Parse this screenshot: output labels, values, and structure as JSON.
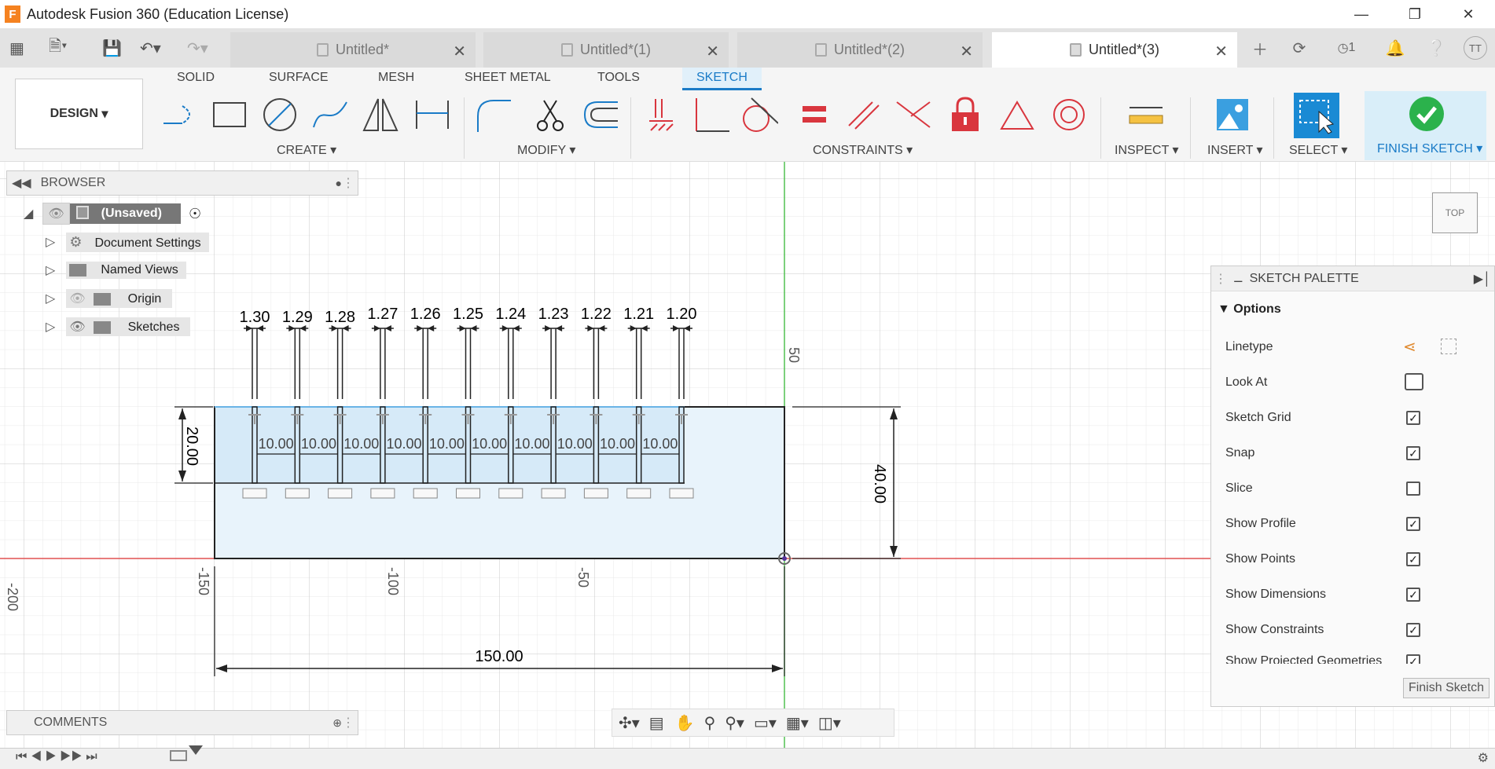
{
  "window": {
    "title": "Autodesk Fusion 360 (Education License)",
    "logo": "F"
  },
  "tabs": [
    {
      "label": "Untitled*",
      "active": false
    },
    {
      "label": "Untitled*(1)",
      "active": false
    },
    {
      "label": "Untitled*(2)",
      "active": false
    },
    {
      "label": "Untitled*(3)",
      "active": true
    }
  ],
  "top_right": {
    "jobs_count": "1",
    "user_initials": "TT"
  },
  "ribbon": {
    "workspace": "DESIGN",
    "tabs": [
      "SOLID",
      "SURFACE",
      "MESH",
      "SHEET METAL",
      "TOOLS",
      "SKETCH"
    ],
    "active_tab": "SKETCH",
    "groups": [
      "CREATE",
      "MODIFY",
      "CONSTRAINTS",
      "INSPECT",
      "INSERT",
      "SELECT",
      "FINISH SKETCH"
    ]
  },
  "browser": {
    "title": "BROWSER",
    "root": "(Unsaved)",
    "items": [
      "Document Settings",
      "Named Views",
      "Origin",
      "Sketches"
    ]
  },
  "palette": {
    "title": "SKETCH PALETTE",
    "section": "Options",
    "rows": [
      {
        "label": "Linetype",
        "kind": "icon"
      },
      {
        "label": "Look At",
        "kind": "icon"
      },
      {
        "label": "Sketch Grid",
        "kind": "check",
        "checked": true
      },
      {
        "label": "Snap",
        "kind": "check",
        "checked": true
      },
      {
        "label": "Slice",
        "kind": "check",
        "checked": false
      },
      {
        "label": "Show Profile",
        "kind": "check",
        "checked": true
      },
      {
        "label": "Show Points",
        "kind": "check",
        "checked": true
      },
      {
        "label": "Show Dimensions",
        "kind": "check",
        "checked": true
      },
      {
        "label": "Show Constraints",
        "kind": "check",
        "checked": true
      },
      {
        "label": "Show Projected Geometries",
        "kind": "check",
        "checked": true
      }
    ],
    "finish_button": "Finish Sketch"
  },
  "comments": {
    "title": "COMMENTS"
  },
  "viewcube": {
    "face": "TOP"
  },
  "sketch": {
    "axis_labels_x": [
      "-200",
      "-150",
      "-100",
      "-50"
    ],
    "axis_labels_y": [
      "50"
    ],
    "width_dim": "150.00",
    "height_dim": "40.00",
    "slot_height_dim": "20.00",
    "slot_widths": [
      "1.30",
      "1.29",
      "1.28",
      "1.27",
      "1.26",
      "1.25",
      "1.24",
      "1.23",
      "1.22",
      "1.21",
      "1.20"
    ],
    "spacing_dims": [
      "10.00",
      "10.00",
      "10.00",
      "10.00",
      "10.00",
      "10.00",
      "10.00",
      "10.00",
      "10.00",
      "10.00"
    ]
  },
  "colors": {
    "accent": "#1a7bc7",
    "constraint_red": "#d9363e",
    "finish_green": "#2bb24c"
  }
}
